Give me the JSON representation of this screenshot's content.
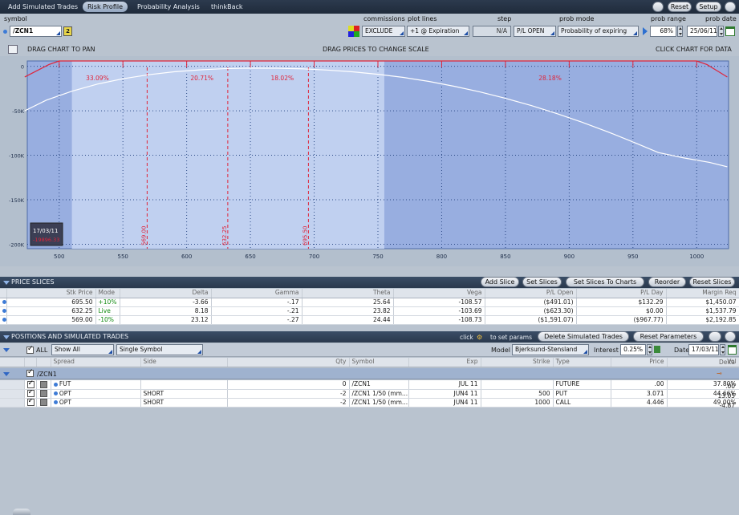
{
  "tabs": [
    "Add Simulated Trades",
    "Risk Profile",
    "Probability Analysis",
    "thinkBack"
  ],
  "top_buttons": {
    "reset": "Reset",
    "setup": "Setup"
  },
  "controls": {
    "symbol_label": "symbol",
    "symbol_value": "/ZCN1",
    "symbol_badge": "2",
    "commissions_label": "commissions",
    "commissions_value": "EXCLUDE",
    "plot_lines_label": "plot lines",
    "plot_lines_value": "+1 @ Expiration",
    "step_label": "step",
    "step_value": "N/A",
    "step_mode": "P/L OPEN",
    "prob_mode_label": "prob mode",
    "prob_mode_value": "Probability of expiring",
    "prob_range_label": "prob range",
    "prob_range_value": "68%",
    "prob_date_label": "prob date",
    "prob_date_value": "25/06/11"
  },
  "chart_header": {
    "left": "DRAG CHART TO PAN",
    "center": "DRAG PRICES TO CHANGE SCALE",
    "right": "CLICK CHART FOR DATA"
  },
  "chart_data": {
    "type": "line",
    "x_ticks": [
      500,
      550,
      600,
      650,
      700,
      750,
      800,
      850,
      900,
      950,
      1000
    ],
    "y_ticks": [
      0,
      -50,
      -100,
      -150,
      -200
    ],
    "y_tick_labels": [
      "0",
      "-50K",
      "-100K",
      "-150K",
      "-200K"
    ],
    "xlim": [
      475,
      1025
    ],
    "ylim": [
      -205000,
      6000
    ],
    "grid": true,
    "series": [
      {
        "values_note": "",
        "x": [
          473,
          490,
          510,
          530,
          550,
          570,
          590,
          610,
          630,
          650,
          670,
          690,
          710,
          730,
          750,
          770,
          790,
          810,
          830,
          850,
          870,
          890,
          910,
          930,
          950,
          970,
          990,
          1010,
          1024
        ],
        "y": [
          -50000,
          -38000,
          -28000,
          -20000,
          -14000,
          -9500,
          -6200,
          -4000,
          -2600,
          -2000,
          -2100,
          -2800,
          -4200,
          -6200,
          -9000,
          -12500,
          -17000,
          -22500,
          -28800,
          -36000,
          -44000,
          -53000,
          -62800,
          -73500,
          -85000,
          -97000,
          -103000,
          -108000,
          -113000
        ]
      },
      {
        "x": [
          473,
          492,
          500,
          1000,
          1008,
          1024
        ],
        "y": [
          -12000,
          2000,
          6000,
          6000,
          2000,
          -12000
        ]
      }
    ],
    "slice_prices": [
      569.0,
      632.25,
      695.5
    ],
    "slice_labels": [
      "569.00",
      "632.25",
      "695.50"
    ],
    "zone_lines": [
      500,
      550,
      600,
      650,
      700,
      750,
      800,
      850,
      900,
      950,
      1000
    ],
    "prob_labels": [
      "33.09%",
      "20.71%",
      "18.02%",
      "28.18%"
    ],
    "prob_label_x": [
      530,
      612,
      675,
      885
    ],
    "date_box": {
      "date": "17/03/11",
      "value": "-19896.33"
    }
  },
  "price_slices": {
    "title": "PRICE SLICES",
    "buttons": [
      "Add Slice",
      "Set Slices",
      "Set Slices To Charts",
      "Reorder",
      "Reset Slices"
    ],
    "columns": [
      "Stk Price",
      "Mode",
      "Delta",
      "Gamma",
      "Theta",
      "Vega",
      "P/L Open",
      "P/L Day",
      "Margin Req"
    ],
    "rows": [
      [
        "695.50",
        "+10%",
        "-3.66",
        "-.17",
        "25.64",
        "-108.57",
        "($491.01)",
        "$132.29",
        "$1,450.07"
      ],
      [
        "632.25",
        "Live",
        "8.18",
        "-.21",
        "23.82",
        "-103.69",
        "($623.30)",
        "$0.00",
        "$1,537.79"
      ],
      [
        "569.00",
        "-10%",
        "23.12",
        "-.27",
        "24.44",
        "-108.73",
        "($1,591.07)",
        "($967.77)",
        "$2,192.85"
      ]
    ]
  },
  "positions": {
    "title": "POSITIONS AND SIMULATED TRADES",
    "click_hint_prefix": "click",
    "click_hint_suffix": "to set params",
    "delete_button": "Delete Simulated Trades",
    "reset_params_button": "Reset Parameters",
    "all_label": "ALL",
    "show_value": "Show All",
    "symbol_mode": "Single Symbol",
    "model_label": "Model",
    "model_value": "Bjerksund-Stensland",
    "interest_label": "Interest",
    "interest_value": "0.25%",
    "date_label": "Date",
    "date_value": "17/03/11",
    "columns": [
      "Spread",
      "Side",
      "Qty",
      "Symbol",
      "Exp",
      "Strike",
      "Type",
      "Price",
      "Vol",
      "Delta"
    ],
    "group": "/ZCN1",
    "rows": [
      [
        "FUT",
        "",
        "0",
        "/ZCN1",
        "JUL 11",
        "",
        "FUTURE",
        ".00",
        "37.80%",
        ".00"
      ],
      [
        "OPT",
        "SHORT",
        "-2",
        "/ZCN1 1/50 (mm...",
        "JUN4 11",
        "500",
        "PUT",
        "3.071",
        "44.66%",
        "13.05"
      ],
      [
        "OPT",
        "SHORT",
        "-2",
        "/ZCN1 1/50 (mm...",
        "JUN4 11",
        "1000",
        "CALL",
        "4.446",
        "49.00%",
        "-4.87"
      ]
    ]
  },
  "colors": {
    "accent": "#1e4fa6",
    "chart_bg": "#98aee0",
    "chart_light": "#c0d0f0",
    "red": "#e0243a"
  }
}
